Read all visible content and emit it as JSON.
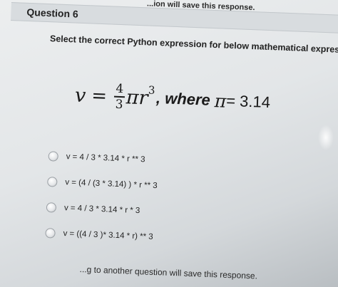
{
  "top_notice": "...ion will save this response.",
  "question": {
    "title": "Question 6",
    "prompt": "Select the correct Python expression for below mathematical expression.",
    "formula": {
      "lhs": "v",
      "equals": "=",
      "frac_num": "4",
      "frac_den": "3",
      "pi_r": "πr",
      "exponent": "3",
      "where": ", where",
      "pi_symbol": "π",
      "pi_equals": " = 3.14"
    }
  },
  "options": [
    {
      "label": "v = 4 / 3 * 3.14 * r ** 3",
      "selected": false
    },
    {
      "label": "v = (4 / (3 * 3.14) ) * r ** 3",
      "selected": false
    },
    {
      "label": "v = 4 / 3 * 3.14 * r * 3",
      "selected": false
    },
    {
      "label": "v = ((4 / 3 )* 3.14 * r) ** 3",
      "selected": false
    }
  ],
  "bottom_notice": "...g to another question will save this response."
}
